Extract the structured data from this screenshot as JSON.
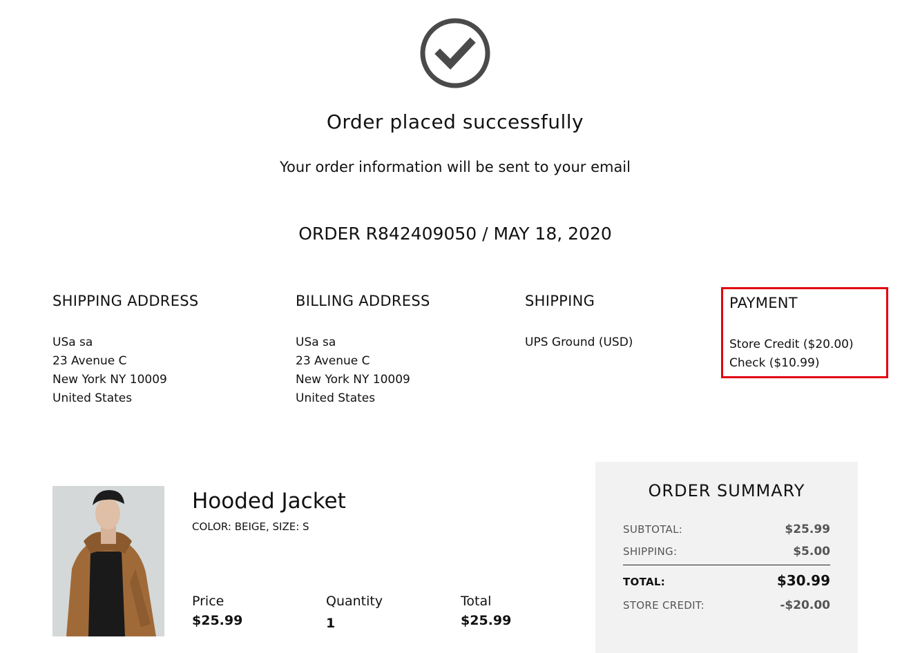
{
  "header": {
    "icon": "checkmark-circle-icon",
    "title": "Order placed successfully",
    "subtitle": "Your order information will be sent to your email",
    "order_line": "ORDER R842409050 / MAY 18, 2020"
  },
  "shipping_address": {
    "heading": "SHIPPING ADDRESS",
    "lines": [
      "USa sa",
      "23 Avenue C",
      "New York NY 10009",
      "United States"
    ]
  },
  "billing_address": {
    "heading": "BILLING ADDRESS",
    "lines": [
      "USa sa",
      "23 Avenue C",
      "New York NY 10009",
      "United States"
    ]
  },
  "shipping": {
    "heading": "SHIPPING",
    "lines": [
      "UPS Ground (USD)"
    ]
  },
  "payment": {
    "heading": "PAYMENT",
    "lines": [
      "Store Credit ($20.00)",
      "Check ($10.99)"
    ],
    "highlight_color": "#e0000e"
  },
  "product": {
    "name": "Hooded Jacket",
    "attributes": "COLOR: BEIGE, SIZE: S",
    "price_label": "Price",
    "price": "$25.99",
    "quantity_label": "Quantity",
    "quantity": "1",
    "total_label": "Total",
    "total": "$25.99"
  },
  "summary": {
    "title": "ORDER SUMMARY",
    "subtotal_label": "SUBTOTAL:",
    "subtotal": "$25.99",
    "shipping_label": "SHIPPING:",
    "shipping": "$5.00",
    "total_label": "TOTAL:",
    "total": "$30.99",
    "store_credit_label": "STORE CREDIT:",
    "store_credit": "-$20.00"
  }
}
